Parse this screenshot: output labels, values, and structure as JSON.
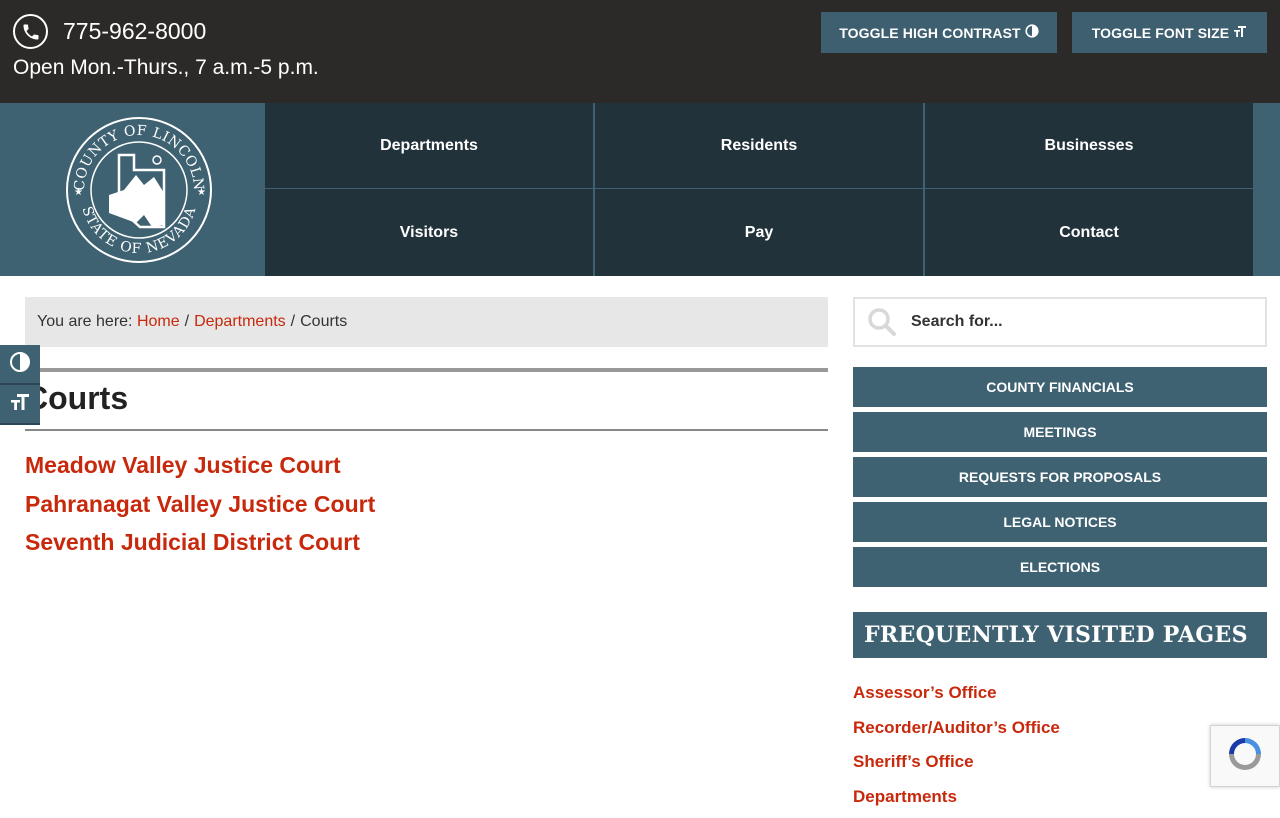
{
  "topbar": {
    "phone": "775-962-8000",
    "hours": "Open Mon.-Thurs., 7 a.m.-5 p.m.",
    "contrast_button": "TOGGLE HIGH CONTRAST",
    "font_button": "TOGGLE FONT SIZE"
  },
  "logo": {
    "top_text": "COUNTY OF LINCOLN",
    "bottom_text": "STATE OF NEVADA"
  },
  "nav": {
    "items": [
      "Departments",
      "Residents",
      "Businesses",
      "Visitors",
      "Pay",
      "Contact"
    ]
  },
  "breadcrumb": {
    "prefix": "You are here:",
    "home": "Home",
    "departments": "Departments",
    "current": "Courts",
    "separator": "/"
  },
  "page": {
    "title": "Courts",
    "links": [
      "Meadow Valley Justice Court",
      "Pahranagat Valley Justice Court",
      "Seventh Judicial District Court"
    ]
  },
  "sidebar": {
    "search_placeholder": "Search for...",
    "buttons": [
      "COUNTY FINANCIALS",
      "MEETINGS",
      "REQUESTS FOR PROPOSALS",
      "LEGAL NOTICES",
      "ELECTIONS"
    ],
    "fv_title": "FREQUENTLY VISITED PAGES",
    "fv_links": [
      "Assessor’s Office",
      "Recorder/Auditor’s Office",
      "Sheriff’s Office",
      "Departments"
    ]
  },
  "colors": {
    "topbar": "#2c2a28",
    "slate": "#3f6272",
    "nav": "#22323a",
    "link": "#c8290c"
  }
}
